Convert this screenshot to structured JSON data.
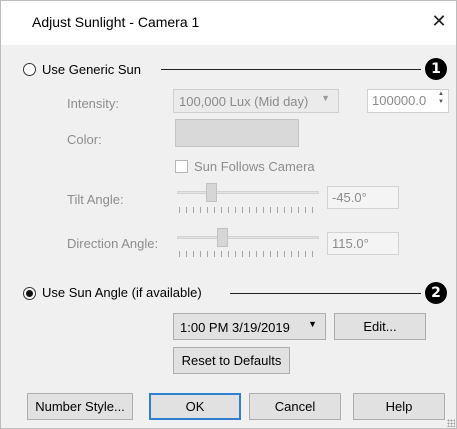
{
  "window": {
    "title": "Adjust Sunlight - Camera 1",
    "close_glyph": "✕"
  },
  "generic_sun": {
    "radio_label": "Use Generic Sun",
    "selected": false,
    "badge": "1",
    "intensity_label": "Intensity:",
    "intensity_preset": "100,000 Lux (Mid day)",
    "intensity_value": "100000.0",
    "color_label": "Color:",
    "color_value": "#d9d9d9",
    "follows_camera_label": "Sun Follows Camera",
    "follows_camera_checked": false,
    "tilt_label": "Tilt Angle:",
    "tilt_value": "-45.0°",
    "direction_label": "Direction Angle:",
    "direction_value": "115.0°"
  },
  "sun_angle": {
    "radio_label": "Use Sun Angle (if available)",
    "selected": true,
    "badge": "2",
    "datetime_value": "1:00 PM 3/19/2019",
    "edit_label": "Edit...",
    "reset_label": "Reset to Defaults"
  },
  "footer": {
    "number_style_label": "Number Style...",
    "ok_label": "OK",
    "cancel_label": "Cancel",
    "help_label": "Help"
  },
  "icons": {
    "close": "close-icon",
    "dropdown": "chevron-down-icon",
    "spinner": "spinner-arrows-icon"
  },
  "colors": {
    "accent": "#2f7fd3",
    "disabled_text": "#8d8d8d",
    "badge": "#000000"
  }
}
